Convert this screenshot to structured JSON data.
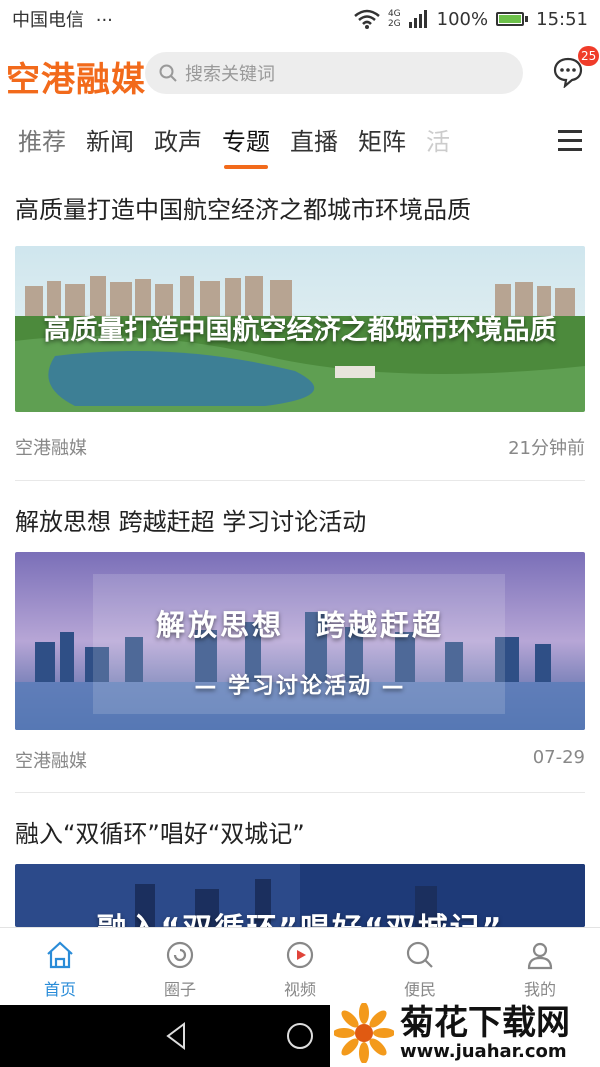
{
  "status_bar": {
    "carrier": "中国电信",
    "dots": "···",
    "network_top": "4G",
    "network_bottom": "2G",
    "battery": "100%",
    "time": "15:51"
  },
  "header": {
    "logo": "空港融媒",
    "search_placeholder": "搜索关键词",
    "message_badge": "25"
  },
  "tabs": [
    {
      "label": "推荐"
    },
    {
      "label": "新闻"
    },
    {
      "label": "政声"
    },
    {
      "label": "专题",
      "active": true
    },
    {
      "label": "直播"
    },
    {
      "label": "矩阵"
    },
    {
      "label": "活"
    }
  ],
  "articles": [
    {
      "title": "高质量打造中国航空经济之都城市环境品质",
      "banner": "高质量打造中国航空经济之都城市环境品质",
      "source": "空港融媒",
      "time": "21分钟前"
    },
    {
      "title": "解放思想 跨越赶超 学习讨论活动",
      "banner_line1": "解放思想　跨越赶超",
      "banner_line2": "— 学习讨论活动 —",
      "source": "空港融媒",
      "time": "07-29"
    },
    {
      "title": "融入“双循环”唱好“双城记”",
      "banner": "融入“双循环”唱好“双城记”"
    }
  ],
  "bottom_nav": [
    {
      "label": "首页",
      "icon": "home-icon",
      "active": true
    },
    {
      "label": "圈子",
      "icon": "circle-icon"
    },
    {
      "label": "视频",
      "icon": "video-icon"
    },
    {
      "label": "便民",
      "icon": "search-icon"
    },
    {
      "label": "我的",
      "icon": "user-icon"
    }
  ],
  "watermark": {
    "title": "菊花下载网",
    "url": "www.juahar.com"
  },
  "colors": {
    "accent": "#f26a1b",
    "active_nav": "#2a8cd8",
    "badge": "#f03c2a"
  }
}
